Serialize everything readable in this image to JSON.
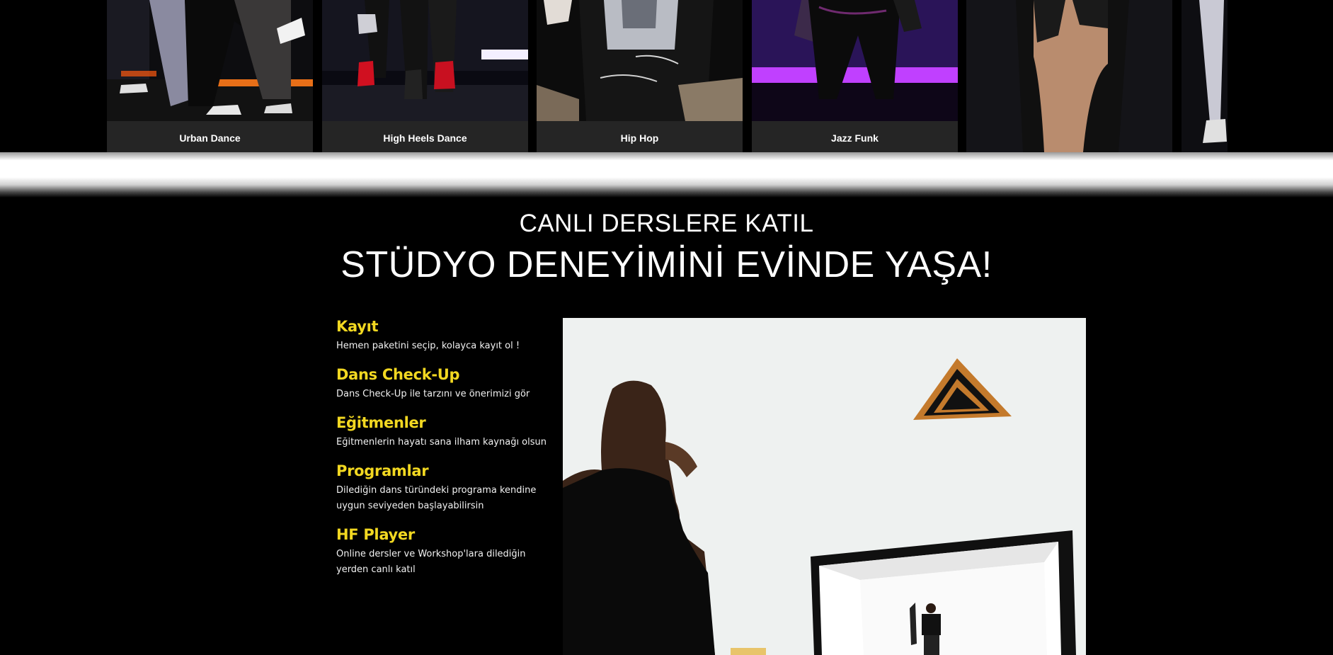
{
  "carousel": {
    "items": [
      {
        "label": "Urban Dance",
        "icon": "urban-dance-photo"
      },
      {
        "label": "High Heels Dance",
        "icon": "high-heels-dance-photo"
      },
      {
        "label": "Hip Hop",
        "icon": "hip-hop-photo"
      },
      {
        "label": "Jazz Funk",
        "icon": "jazz-funk-photo"
      },
      {
        "label": "",
        "icon": "dance-photo"
      },
      {
        "label": "",
        "icon": "dance-photo"
      }
    ]
  },
  "section": {
    "subtitle": "CANLI DERSLERE KATIL",
    "title": "STÜDYO DENEYİMİNİ EVİNDE YAŞA!"
  },
  "features": [
    {
      "title": "Kayıt",
      "text": "Hemen paketini seçip, kolayca kayıt ol !"
    },
    {
      "title": "Dans Check-Up",
      "text": "Dans Check-Up ile tarzını ve önerimizi gör"
    },
    {
      "title": "Eğitmenler",
      "text": "Eğitmenlerin hayatı sana ilham kaynağı olsun"
    },
    {
      "title": "Programlar",
      "text": "Dilediğin dans türündeki programa kendine uygun seviyeden başlayabilirsin"
    },
    {
      "title": "HF Player",
      "text": "Online dersler ve Workshop'lara dilediğin yerden canlı katıl"
    }
  ],
  "hero": {
    "icon": "dancer-with-screen-photo"
  },
  "colors": {
    "accent": "#f2d821",
    "background": "#000000",
    "caption_bg": "#252525"
  }
}
